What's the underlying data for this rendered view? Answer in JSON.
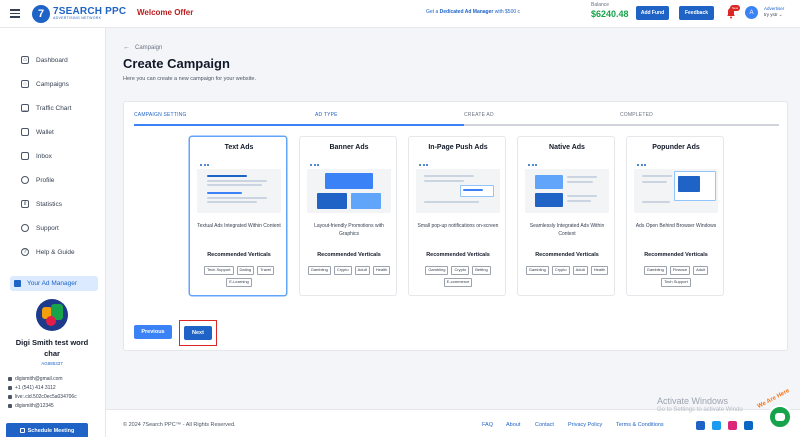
{
  "header": {
    "logo_title": "7SEARCH PPC",
    "logo_sub": "ADVERTISING NETWORK",
    "welcome": "Welcome Offer",
    "dedicated_prefix": "Get a ",
    "dedicated_bold": "Dedicated Ad Manager",
    "dedicated_suffix": " with $500 c",
    "balance_label": "Balance",
    "balance_value": "$6240.48",
    "add_fund": "Add Fund",
    "feedback": "Feedback",
    "bell_badge": "New",
    "avatar_initial": "A",
    "user_role": "Advertiser",
    "user_name": "try ystr ⌄"
  },
  "sidebar": {
    "items": [
      {
        "label": "Dashboard",
        "icon": "home-icon"
      },
      {
        "label": "Campaigns",
        "icon": "campaigns-icon"
      },
      {
        "label": "Traffic Chart",
        "icon": "chart-icon"
      },
      {
        "label": "Wallet",
        "icon": "wallet-icon"
      },
      {
        "label": "Inbox",
        "icon": "inbox-icon"
      },
      {
        "label": "Profile",
        "icon": "profile-icon"
      },
      {
        "label": "Statistics",
        "icon": "statistics-icon"
      },
      {
        "label": "Support",
        "icon": "support-icon"
      },
      {
        "label": "Help & Guide",
        "icon": "help-icon"
      }
    ],
    "ad_manager_label": "Your Ad Manager",
    "manager": {
      "name_line1": "Digi Smith test word",
      "name_line2": "char",
      "id": "AG885337",
      "email": "digismith@gmail.com",
      "phone": "+1 (541) 414 3112",
      "skype": "live:.cid.502c0ec5a034706c",
      "telegram": "digismith@12345"
    },
    "schedule_label": "Schedule Meeting"
  },
  "main": {
    "breadcrumb": "Campaign",
    "title": "Create Campaign",
    "subtitle": "Here you can create a new campaign for your website.",
    "steps": [
      {
        "label": "CAMPAIGN SETTING",
        "state": "done"
      },
      {
        "label": "AD TYPE",
        "state": "active"
      },
      {
        "label": "CREATE AD",
        "state": "todo"
      },
      {
        "label": "COMPLETED",
        "state": "todo"
      }
    ],
    "ad_types": [
      {
        "title": "Text Ads",
        "desc": "Textual Ads Integrated Within Content",
        "rec": "Recommended Verticals",
        "tags": [
          "Tech Support",
          "Dating",
          "Travel",
          "E-Learning"
        ],
        "selected": true
      },
      {
        "title": "Banner Ads",
        "desc": "Layout-friendly Promotions with Graphics",
        "rec": "Recommended Verticals",
        "tags": [
          "Gambling",
          "Crypto",
          "Adult",
          "Health"
        ],
        "selected": false
      },
      {
        "title": "In-Page Push Ads",
        "desc": "Small pop-up notifications on-screen",
        "rec": "Recommended Verticals",
        "tags": [
          "Gambling",
          "Crypto",
          "Betting",
          "E-commerce"
        ],
        "selected": false
      },
      {
        "title": "Native Ads",
        "desc": "Seamlessly Integrated Ads Within Context",
        "rec": "Recommended Verticals",
        "tags": [
          "Gambling",
          "Crypto",
          "Adult",
          "Health"
        ],
        "selected": false
      },
      {
        "title": "Popunder Ads",
        "desc": "Ads Open Behind Browser Windows",
        "rec": "Recommended Verticals",
        "tags": [
          "Gambling",
          "Finance",
          "Adult",
          "Tech Support"
        ],
        "selected": false
      }
    ],
    "prev_label": "Previous",
    "next_label": "Next"
  },
  "footer": {
    "copyright": "© 2024 7Search PPC™ - All Rights Reserved.",
    "links": [
      "FAQ",
      "About",
      "Contact",
      "Privacy Policy",
      "Terms & Conditions"
    ],
    "social_icons": [
      "facebook-icon",
      "twitter-icon",
      "instagram-icon",
      "linkedin-icon",
      "pinterest-icon"
    ]
  },
  "overlay": {
    "activate_title": "Activate Windows",
    "activate_sub": "Go to Settings to activate Windo",
    "chat_label": "We Are Here"
  },
  "colors": {
    "primary": "#1e63c5",
    "balance": "#16a34a",
    "welcome": "#b91c1c",
    "highlight": "#dc2626"
  }
}
